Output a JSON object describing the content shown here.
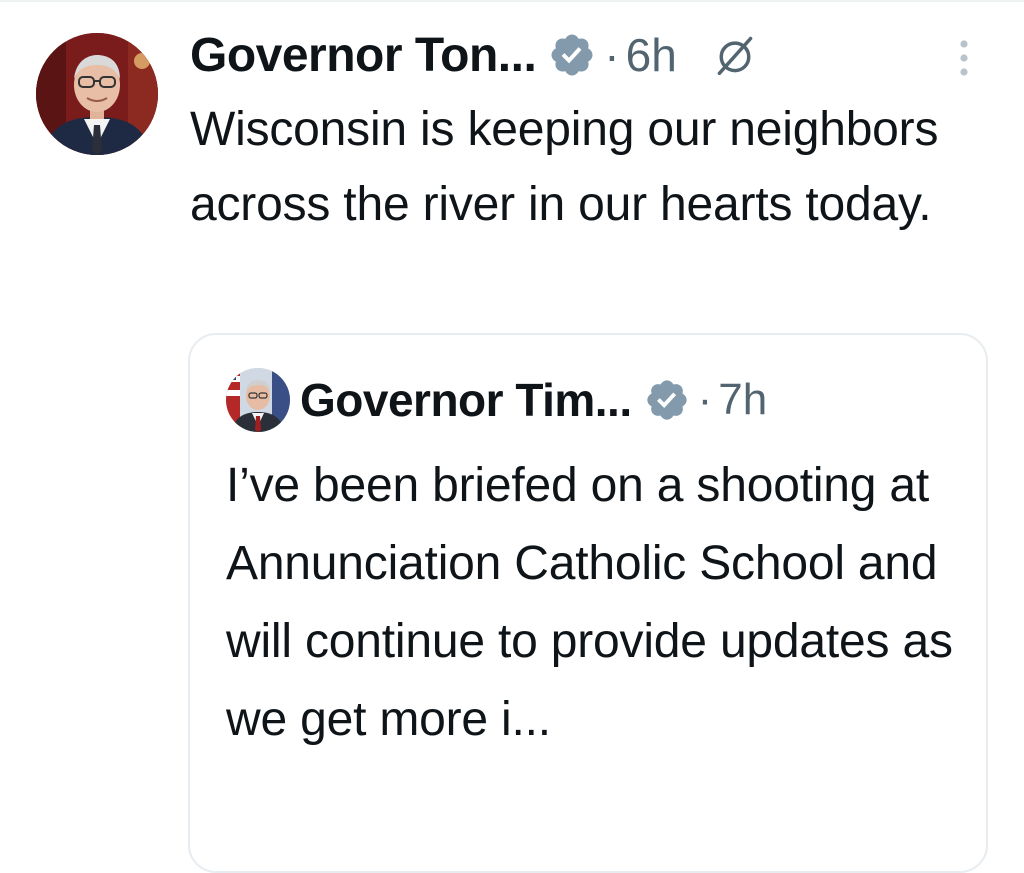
{
  "tweet": {
    "author_name": "Governor Ton...",
    "separator": "·",
    "timestamp": "6h",
    "text": "Wisconsin is keeping our neighbors across the river in our hearts today.",
    "icons": {
      "verified": "verified-badge-icon",
      "grok": "grok-icon",
      "more": "more-options-icon"
    }
  },
  "quoted_tweet": {
    "author_name": "Governor Tim...",
    "separator": "·",
    "timestamp": "7h",
    "text": "I’ve been briefed on a shooting at Annunciation Catholic School and will continue to provide updates as we get more i..."
  },
  "colors": {
    "text": "#0f1419",
    "secondary": "#536471",
    "verified_badge": "#829aab",
    "card_border": "#e6ecf0"
  }
}
